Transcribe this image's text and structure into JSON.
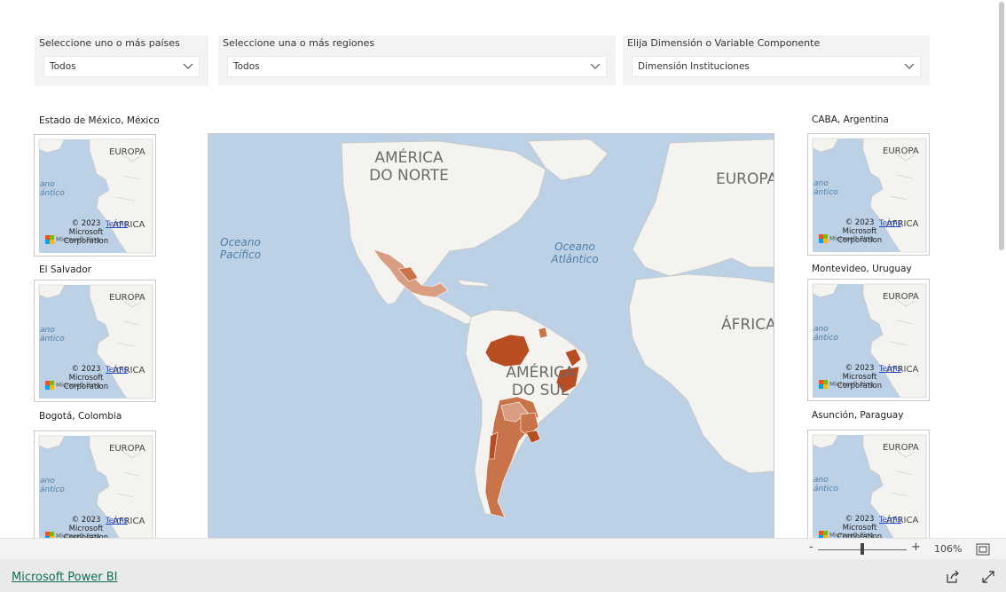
{
  "slicers": [
    {
      "title": "Seleccione uno o más países",
      "value": "Todos"
    },
    {
      "title": "Seleccione una o más regiones",
      "value": "Todos"
    },
    {
      "title": "Elija Dimensión o Variable Componente",
      "value": "Dimensión Instituciones"
    }
  ],
  "minimaps_left": [
    {
      "title": "Estado de México, México"
    },
    {
      "title": "El Salvador"
    },
    {
      "title": "Bogotá, Colombia"
    }
  ],
  "minimaps_right": [
    {
      "title": "CABA, Argentina"
    },
    {
      "title": "Montevideo, Uruguay"
    },
    {
      "title": "Asunción, Paraguay"
    }
  ],
  "minimap_labels": {
    "europa": "EUROPA",
    "africa": "ÁFRICA",
    "oceano_fragment": "ano",
    "atlantico_fragment": "ántico",
    "copyright_year": "© 2023",
    "copyright_company": "Microsoft",
    "copyright_corp": "Corporation",
    "terms": "Terms",
    "bing_watermark": "Microsoft Bing"
  },
  "main_map": {
    "label_north_america_1": "AMÉRICA",
    "label_north_america_2": "DO NORTE",
    "label_south_america_1": "AMÉRICA",
    "label_south_america_2": "DO SUL",
    "label_europe": "EUROPA",
    "label_africa": "ÁFRICA",
    "label_pacific_1": "Oceano",
    "label_pacific_2": "Pacífico",
    "label_atlantic_1": "Oceano",
    "label_atlantic_2": "Atlântico"
  },
  "colors": {
    "ocean": "#bcd0e6",
    "land": "#f4f3ef",
    "choropleth_dark": "#b84d22",
    "choropleth_mid": "#c9734a",
    "choropleth_light": "#d99d82"
  },
  "statusbar": {
    "zoom_minus": "-",
    "zoom_plus": "+",
    "zoom_value": "106%"
  },
  "footer": {
    "brand": "Microsoft Power BI"
  }
}
